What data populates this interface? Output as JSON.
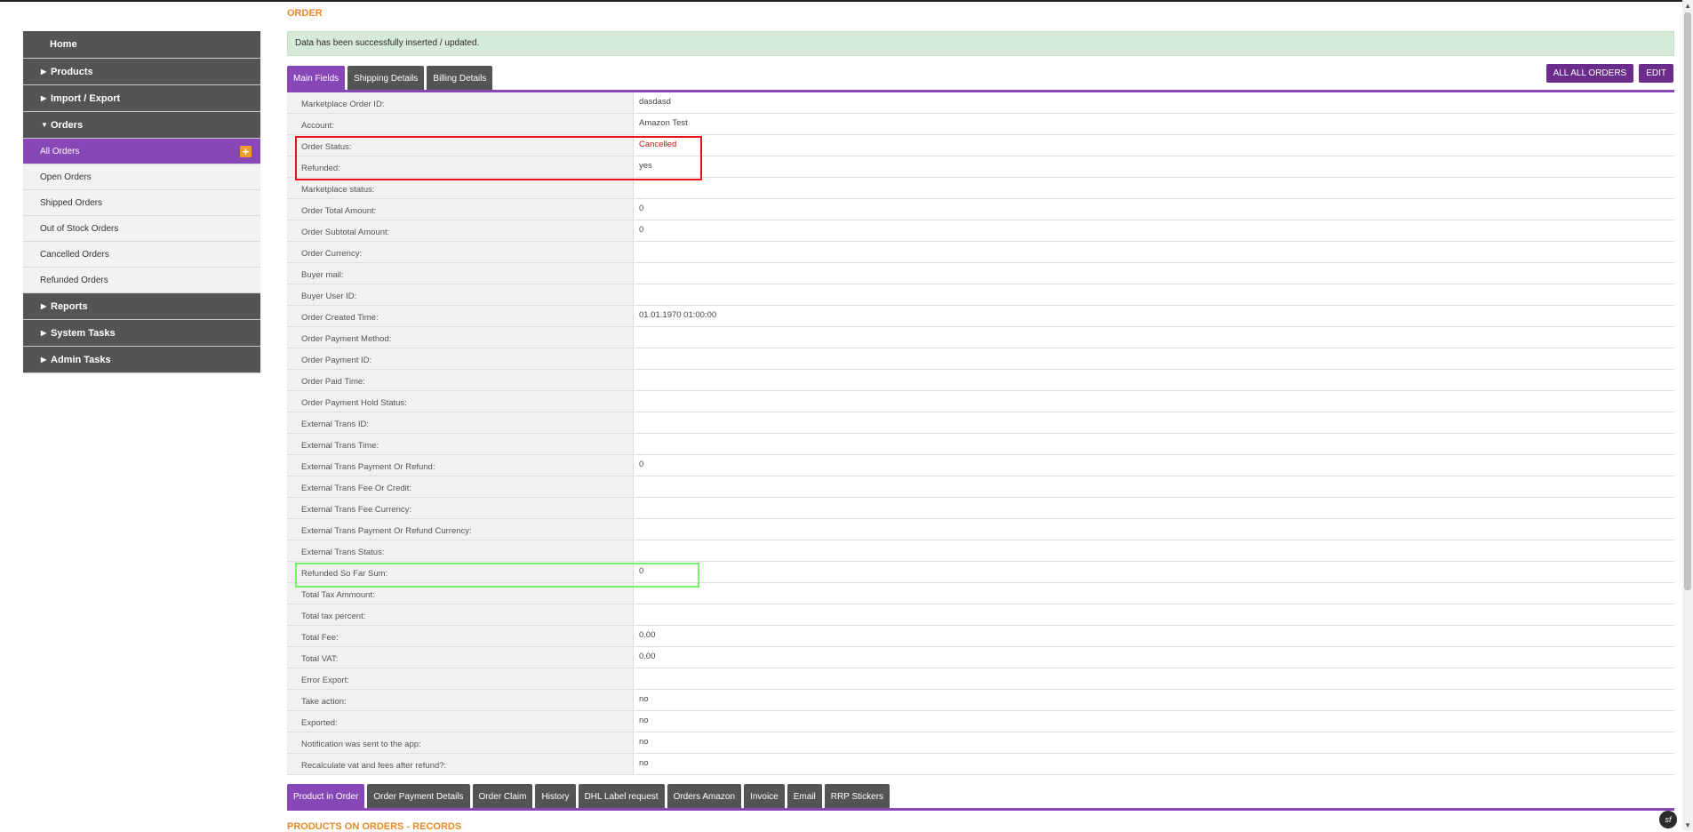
{
  "sidebar": {
    "home": "Home",
    "products": "Products",
    "import_export": "Import / Export",
    "orders": "Orders",
    "order_items": [
      "All Orders",
      "Open Orders",
      "Shipped Orders",
      "Out of Stock Orders",
      "Cancelled Orders",
      "Refunded Orders"
    ],
    "reports": "Reports",
    "system_tasks": "System Tasks",
    "admin_tasks": "Admin Tasks",
    "plus_symbol": "+",
    "arrow_collapsed": "▶",
    "arrow_expanded": "▼"
  },
  "page": {
    "title": "ORDER",
    "alert": "Data has been successfully inserted / updated."
  },
  "tabs": [
    "Main Fields",
    "Shipping Details",
    "Billing Details"
  ],
  "actions": {
    "all_orders": "ALL ALL ORDERS",
    "edit": "EDIT"
  },
  "fields": [
    {
      "label": "Marketplace Order ID:",
      "value": "dasdasd"
    },
    {
      "label": "Account:",
      "value": "Amazon Test"
    },
    {
      "label": "Order Status:",
      "value": "Cancelled",
      "highlight": "red-text"
    },
    {
      "label": "Refunded:",
      "value": "yes"
    },
    {
      "label": "Marketplace status:",
      "value": ""
    },
    {
      "label": "Order Total Amount:",
      "value": "0"
    },
    {
      "label": "Order Subtotal Amount:",
      "value": "0"
    },
    {
      "label": "Order Currency:",
      "value": ""
    },
    {
      "label": "Buyer mail:",
      "value": ""
    },
    {
      "label": "Buyer User ID:",
      "value": ""
    },
    {
      "label": "Order Created Time:",
      "value": "01.01.1970 01:00:00"
    },
    {
      "label": "Order Payment Method:",
      "value": ""
    },
    {
      "label": "Order Payment ID:",
      "value": ""
    },
    {
      "label": "Order Paid Time:",
      "value": ""
    },
    {
      "label": "Order Payment Hold Status:",
      "value": ""
    },
    {
      "label": "External Trans ID:",
      "value": ""
    },
    {
      "label": "External Trans Time:",
      "value": ""
    },
    {
      "label": "External Trans Payment Or Refund:",
      "value": "0"
    },
    {
      "label": "External Trans Fee Or Credit:",
      "value": ""
    },
    {
      "label": "External Trans Fee Currency:",
      "value": ""
    },
    {
      "label": "External Trans Payment Or Refund Currency:",
      "value": ""
    },
    {
      "label": "External Trans Status:",
      "value": ""
    },
    {
      "label": "Refunded So Far Sum:",
      "value": "0"
    },
    {
      "label": "Total Tax Ammount:",
      "value": ""
    },
    {
      "label": "Total tax percent:",
      "value": ""
    },
    {
      "label": "Total Fee:",
      "value": "0.00"
    },
    {
      "label": "Total VAT:",
      "value": "0.00"
    },
    {
      "label": "Error Export:",
      "value": ""
    },
    {
      "label": "Take action:",
      "value": "no"
    },
    {
      "label": "Exported:",
      "value": "no"
    },
    {
      "label": "Notification was sent to the app:",
      "value": "no"
    },
    {
      "label": "Recalculate vat and fees after refund?:",
      "value": "no"
    }
  ],
  "bottom_tabs": [
    "Product in Order",
    "Order Payment Details",
    "Order Claim",
    "History",
    "DHL Label request",
    "Orders Amazon",
    "Invoice",
    "Email",
    "RRP Stickers"
  ],
  "section_title": "PRODUCTS ON ORDERS - RECORDS",
  "scroll": {
    "up": "▲",
    "down": "▼"
  },
  "badge": "sf",
  "colors": {
    "accent": "#8847b7",
    "nav_dark": "#545454",
    "title_orange": "#e88a2a",
    "status_red": "#cc1111",
    "highlight_red": "#e8141b",
    "highlight_green": "#74f36a"
  }
}
